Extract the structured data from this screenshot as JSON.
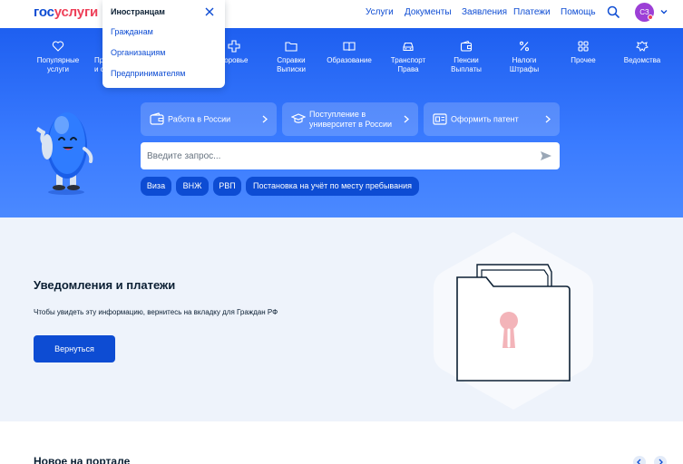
{
  "header": {
    "logo_part1": "гос",
    "logo_part2": "услуги",
    "nav": [
      "Услуги",
      "Документы",
      "Заявления",
      "Платежи",
      "Помощь"
    ],
    "avatar_initials": "СЗ"
  },
  "dropdown": {
    "title": "Иностранцам",
    "items": [
      "Гражданам",
      "Организациям",
      "Предпринимателям"
    ]
  },
  "categories": [
    {
      "icon": "heart-icon",
      "label": "Популярные\nуслуги"
    },
    {
      "icon": "category-icon",
      "label": "Пр\nи с"
    },
    {
      "icon": "health-cross-icon",
      "label": "доровье"
    },
    {
      "icon": "folder-icon",
      "label": "Справки\nВыписки"
    },
    {
      "icon": "book-icon",
      "label": "Образование"
    },
    {
      "icon": "car-icon",
      "label": "Транспорт\nПрава"
    },
    {
      "icon": "wallet-icon",
      "label": "Пенсии\nВыплаты"
    },
    {
      "icon": "percent-icon",
      "label": "Налоги\nШтрафы"
    },
    {
      "icon": "grid-icon",
      "label": "Прочее"
    },
    {
      "icon": "emblem-icon",
      "label": "Ведомства"
    }
  ],
  "quick_links": [
    {
      "icon": "wallet-icon",
      "label": "Работа в России"
    },
    {
      "icon": "graduation-cap-icon",
      "label": "Поступление в\nуниверситет в России"
    },
    {
      "icon": "document-icon",
      "label": "Оформить патент"
    }
  ],
  "search": {
    "placeholder": "Введите запрос..."
  },
  "chips": [
    "Виза",
    "ВНЖ",
    "РВП",
    "Постановка на учёт по месту пребывания"
  ],
  "notice": {
    "title": "Уведомления и платежи",
    "description": "Чтобы увидеть эту информацию, вернитесь на вкладку для Граждан РФ",
    "button": "Вернуться"
  },
  "news": {
    "title": "Новое на портале"
  },
  "colors": {
    "primary": "#0d4cd3",
    "accent": "#ee3f58",
    "hero_top": "#1e5ff0",
    "notice_bg": "#eef3fb"
  }
}
